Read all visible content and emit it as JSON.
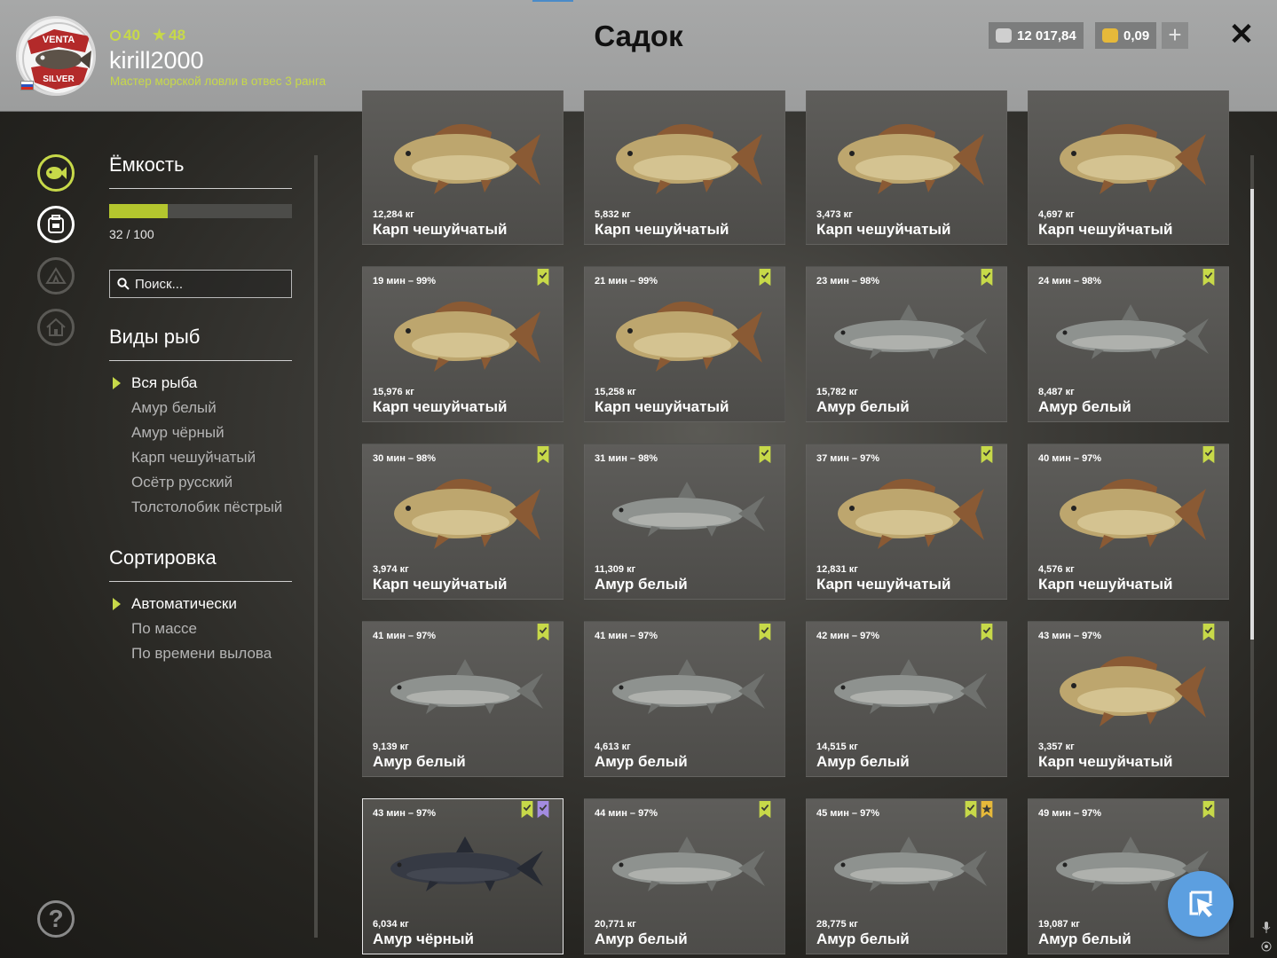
{
  "header": {
    "title": "Садок",
    "level": "40",
    "stars": "48",
    "username": "kirill2000",
    "rank": "Мастер морской ловли в отвес 3 ранга",
    "avatar_text_top": "VENTA",
    "avatar_text_bottom": "SILVER",
    "silver": "12 017,84",
    "gold": "0,09",
    "plus": "+",
    "close": "✕"
  },
  "capacity": {
    "heading": "Ёмкость",
    "used": 32,
    "total": 100,
    "text": "32 / 100"
  },
  "search": {
    "placeholder": "Поиск..."
  },
  "species": {
    "heading": "Виды рыб",
    "items": [
      "Вся рыба",
      "Амур белый",
      "Амур чёрный",
      "Карп чешуйчатый",
      "Осётр русский",
      "Толстолобик пёстрый"
    ],
    "active": 0
  },
  "sorting": {
    "heading": "Сортировка",
    "items": [
      "Автоматически",
      "По массе",
      "По времени вылова"
    ],
    "active": 0
  },
  "help": "?",
  "fish": [
    {
      "time": "",
      "weight": "12,284 кг",
      "name": "Карп чешуйчатый",
      "kind": "carp",
      "badges": []
    },
    {
      "time": "",
      "weight": "5,832 кг",
      "name": "Карп чешуйчатый",
      "kind": "carp",
      "badges": []
    },
    {
      "time": "",
      "weight": "3,473 кг",
      "name": "Карп чешуйчатый",
      "kind": "carp",
      "badges": []
    },
    {
      "time": "",
      "weight": "4,697 кг",
      "name": "Карп чешуйчатый",
      "kind": "carp",
      "badges": []
    },
    {
      "time": "19 мин – 99%",
      "weight": "15,976 кг",
      "name": "Карп чешуйчатый",
      "kind": "carp",
      "badges": [
        "check"
      ]
    },
    {
      "time": "21 мин – 99%",
      "weight": "15,258 кг",
      "name": "Карп чешуйчатый",
      "kind": "carp",
      "badges": [
        "check"
      ]
    },
    {
      "time": "23 мин – 98%",
      "weight": "15,782 кг",
      "name": "Амур белый",
      "kind": "amur",
      "badges": [
        "check"
      ]
    },
    {
      "time": "24 мин – 98%",
      "weight": "8,487 кг",
      "name": "Амур белый",
      "kind": "amur",
      "badges": [
        "check"
      ]
    },
    {
      "time": "30 мин – 98%",
      "weight": "3,974 кг",
      "name": "Карп чешуйчатый",
      "kind": "carp",
      "badges": [
        "check"
      ]
    },
    {
      "time": "31 мин – 98%",
      "weight": "11,309 кг",
      "name": "Амур белый",
      "kind": "amur",
      "badges": [
        "check"
      ]
    },
    {
      "time": "37 мин – 97%",
      "weight": "12,831 кг",
      "name": "Карп чешуйчатый",
      "kind": "carp",
      "badges": [
        "check"
      ]
    },
    {
      "time": "40 мин – 97%",
      "weight": "4,576 кг",
      "name": "Карп чешуйчатый",
      "kind": "carp",
      "badges": [
        "check"
      ]
    },
    {
      "time": "41 мин – 97%",
      "weight": "9,139 кг",
      "name": "Амур белый",
      "kind": "amur",
      "badges": [
        "check"
      ]
    },
    {
      "time": "41 мин – 97%",
      "weight": "4,613 кг",
      "name": "Амур белый",
      "kind": "amur",
      "badges": [
        "check"
      ]
    },
    {
      "time": "42 мин – 97%",
      "weight": "14,515 кг",
      "name": "Амур белый",
      "kind": "amur",
      "badges": [
        "check"
      ]
    },
    {
      "time": "43 мин – 97%",
      "weight": "3,357 кг",
      "name": "Карп чешуйчатый",
      "kind": "carp",
      "badges": [
        "check"
      ]
    },
    {
      "time": "43 мин – 97%",
      "weight": "6,034 кг",
      "name": "Амур чёрный",
      "kind": "black",
      "badges": [
        "check",
        "purple"
      ],
      "selected": true
    },
    {
      "time": "44 мин – 97%",
      "weight": "20,771 кг",
      "name": "Амур белый",
      "kind": "amur",
      "badges": [
        "check"
      ]
    },
    {
      "time": "45 мин – 97%",
      "weight": "28,775 кг",
      "name": "Амур белый",
      "kind": "amur",
      "badges": [
        "check",
        "star"
      ]
    },
    {
      "time": "49 мин – 97%",
      "weight": "19,087 кг",
      "name": "Амур белый",
      "kind": "amur",
      "badges": [
        "check"
      ]
    }
  ],
  "colors": {
    "accent": "#c7d949",
    "silver_coin": "#cfcfcf",
    "gold_coin": "#e6b93a",
    "badge_green": "#c7d949",
    "badge_purple": "#a38be0",
    "badge_gold": "#e6b93a",
    "fab": "#5c9fe0"
  },
  "icons": {
    "side": [
      "fish-icon",
      "backpack-icon",
      "tent-icon",
      "home-icon"
    ],
    "fab": "cursor-icon",
    "mic": "mic-icon",
    "target": "target-icon"
  }
}
